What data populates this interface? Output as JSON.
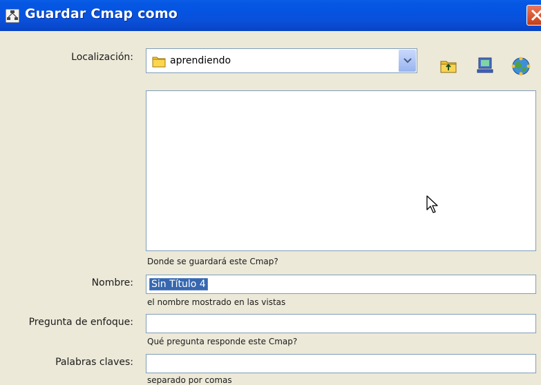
{
  "window": {
    "title": "Guardar Cmap como"
  },
  "location": {
    "label": "Localización:",
    "value": "aprendiendo",
    "hint": "Donde se guardará este Cmap?"
  },
  "toolbar": {
    "icons": [
      "folder-up-icon",
      "computer-icon",
      "globe-network-icon"
    ]
  },
  "name_field": {
    "label": "Nombre:",
    "value": "Sin Título 4",
    "hint": "el nombre mostrado en las vistas"
  },
  "focus_question": {
    "label": "Pregunta de enfoque:",
    "value": "",
    "hint": "Qué pregunta responde este Cmap?"
  },
  "keywords": {
    "label": "Palabras claves:",
    "value": "",
    "hint": "separado por comas"
  },
  "colors": {
    "titlebar": "#0555e2",
    "dialog_bg": "#ece9d8",
    "field_border": "#7f9db9",
    "selection": "#3668b0"
  }
}
